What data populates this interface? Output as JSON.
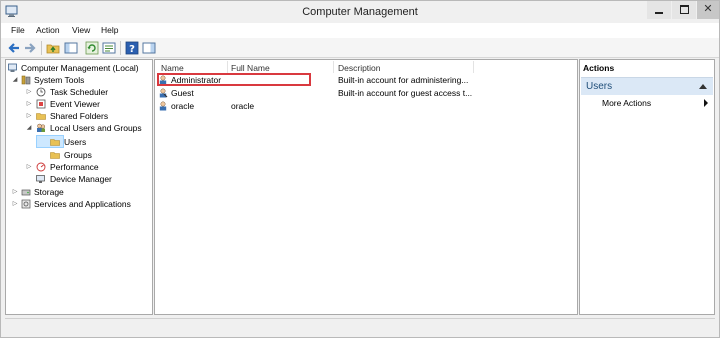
{
  "window": {
    "title": "Computer Management",
    "controls": {
      "minimize": "–",
      "close": "✕"
    }
  },
  "menu": {
    "items": [
      "File",
      "Action",
      "View",
      "Help"
    ]
  },
  "toolbar": {
    "buttons": [
      "back-icon",
      "forward-icon",
      "up-folder-icon",
      "show-hide-tree-icon",
      "refresh-icon",
      "export-list-icon",
      "help-icon",
      "show-hide-action-pane-icon"
    ]
  },
  "tree": {
    "root": "Computer Management (Local)",
    "system_tools": "System Tools",
    "task_scheduler": "Task Scheduler",
    "event_viewer": "Event Viewer",
    "shared_folders": "Shared Folders",
    "local_users_groups": "Local Users and Groups",
    "users": "Users",
    "groups": "Groups",
    "performance": "Performance",
    "device_manager": "Device Manager",
    "storage": "Storage",
    "services_apps": "Services and Applications",
    "expand_open": "◢",
    "expand_closed": "▷"
  },
  "list": {
    "columns": [
      "Name",
      "Full Name",
      "Description"
    ],
    "rows": [
      {
        "name": "Administrator",
        "full_name": "",
        "description": "Built-in account for administering..."
      },
      {
        "name": "Guest",
        "full_name": "",
        "description": "Built-in account for guest access t..."
      },
      {
        "name": "oracle",
        "full_name": "oracle",
        "description": ""
      }
    ]
  },
  "actions": {
    "title": "Actions",
    "section": "Users",
    "more": "More Actions"
  },
  "colors": {
    "selection": "#cde8ff",
    "highlight_border": "#d9393f",
    "actions_header": "#dbe8f6"
  }
}
